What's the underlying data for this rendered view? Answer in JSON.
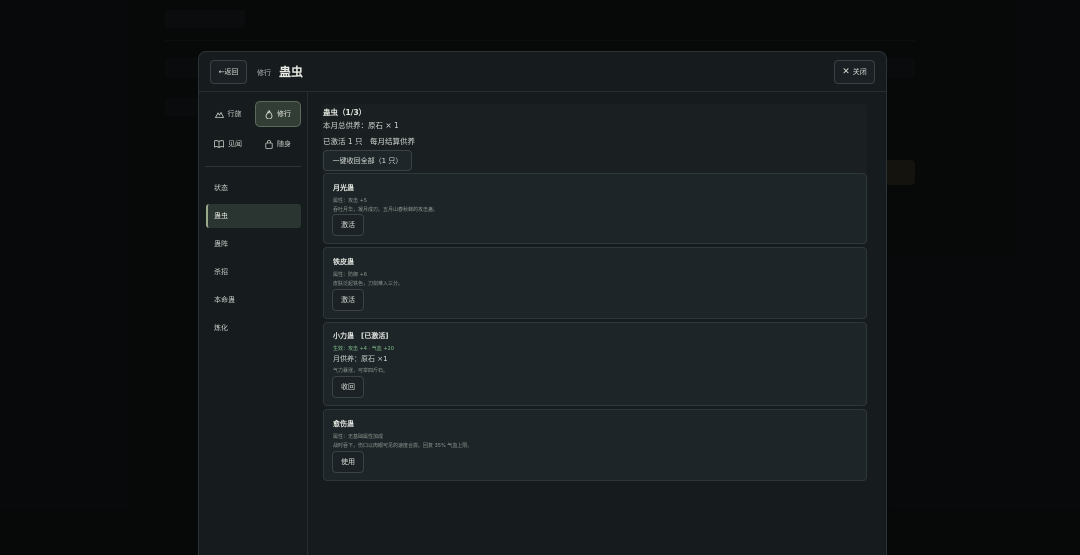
{
  "header": {
    "back_label": "←返回",
    "breadcrumb": "修行",
    "title": "蛊虫",
    "close_label": "关闭"
  },
  "sidebar": {
    "tabs": [
      {
        "label": "行旅",
        "icon": "mountain-icon",
        "active": false
      },
      {
        "label": "修行",
        "icon": "flame-icon",
        "active": true
      },
      {
        "label": "见闻",
        "icon": "book-icon",
        "active": false
      },
      {
        "label": "随身",
        "icon": "bag-icon",
        "active": false
      }
    ],
    "items": [
      {
        "label": "状态",
        "active": false
      },
      {
        "label": "蛊虫",
        "active": true
      },
      {
        "label": "蛊阵",
        "active": false
      },
      {
        "label": "杀招",
        "active": false
      },
      {
        "label": "本命蛊",
        "active": false
      },
      {
        "label": "炼化",
        "active": false
      }
    ]
  },
  "summary": {
    "title": "蛊虫（1/3）",
    "feed_total": "本月总供养：原石 × 1",
    "active_info": "已激活 1 只　每月结算供养",
    "recall_all_label": "一键收回全部（1 只）"
  },
  "cards": [
    {
      "name": "月光蛊",
      "attr": "属性：攻击 +5",
      "desc": "吞吐月华，凝月成刃。五月山春秋蝉的攻击蛊。",
      "button": "激活"
    },
    {
      "name": "铁皮蛊",
      "attr": "属性：防御 +6",
      "desc": "皮肤泛起铁色，刀剑难入三分。",
      "button": "激活"
    },
    {
      "name": "小力蛊　[已激活]",
      "effect": "生效：攻击 +4 · 气血 +20",
      "feed": "月供养：原石 ×1",
      "desc": "气力暴涨，可举四斤石。",
      "button": "收回"
    },
    {
      "name": "愈伤蛊",
      "attr": "属性：无基础属性加成",
      "desc": "战时吞下，伤口以肉眼可见的速度合拢。回复 35% 气血上限。",
      "button": "使用"
    }
  ],
  "colors": {
    "accent": "#9aa98c",
    "effect_green": "#7fbf8d",
    "panel_bg": "#1e2528"
  }
}
